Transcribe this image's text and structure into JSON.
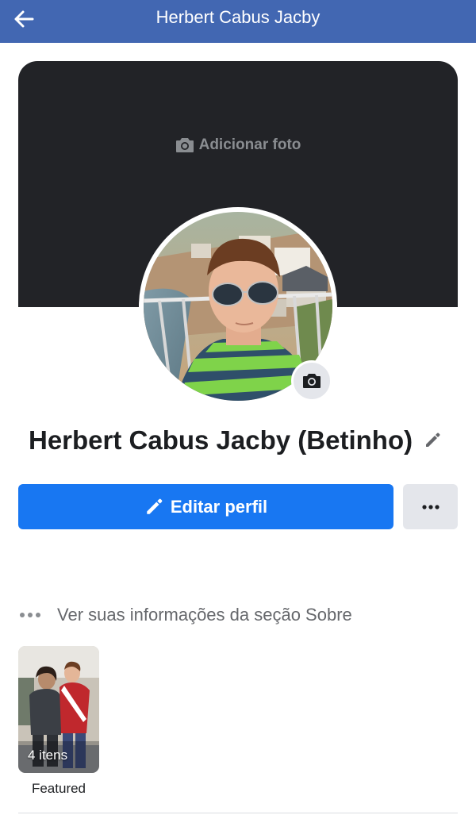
{
  "header": {
    "title": "Herbert Cabus Jacby",
    "back_icon": "arrow-left-icon"
  },
  "cover": {
    "add_photo_label": "Adicionar foto",
    "add_photo_icon": "camera-icon"
  },
  "profile": {
    "name": "Herbert Cabus Jacby (Betinho)",
    "edit_name_icon": "pencil-icon",
    "avatar_camera_icon": "camera-icon"
  },
  "actions": {
    "edit_profile_label": "Editar perfil",
    "edit_profile_icon": "pencil-icon",
    "more_icon": "ellipsis-icon"
  },
  "about": {
    "label": "Ver suas informações da seção Sobre",
    "icon": "ellipsis-icon"
  },
  "featured": {
    "count_label": "4 itens",
    "label": "Featured"
  },
  "colors": {
    "header_bg": "#4267b2",
    "primary_button": "#1877f2",
    "secondary_button": "#e4e6eb",
    "cover_bg": "#222327",
    "muted_text": "#65676b"
  }
}
